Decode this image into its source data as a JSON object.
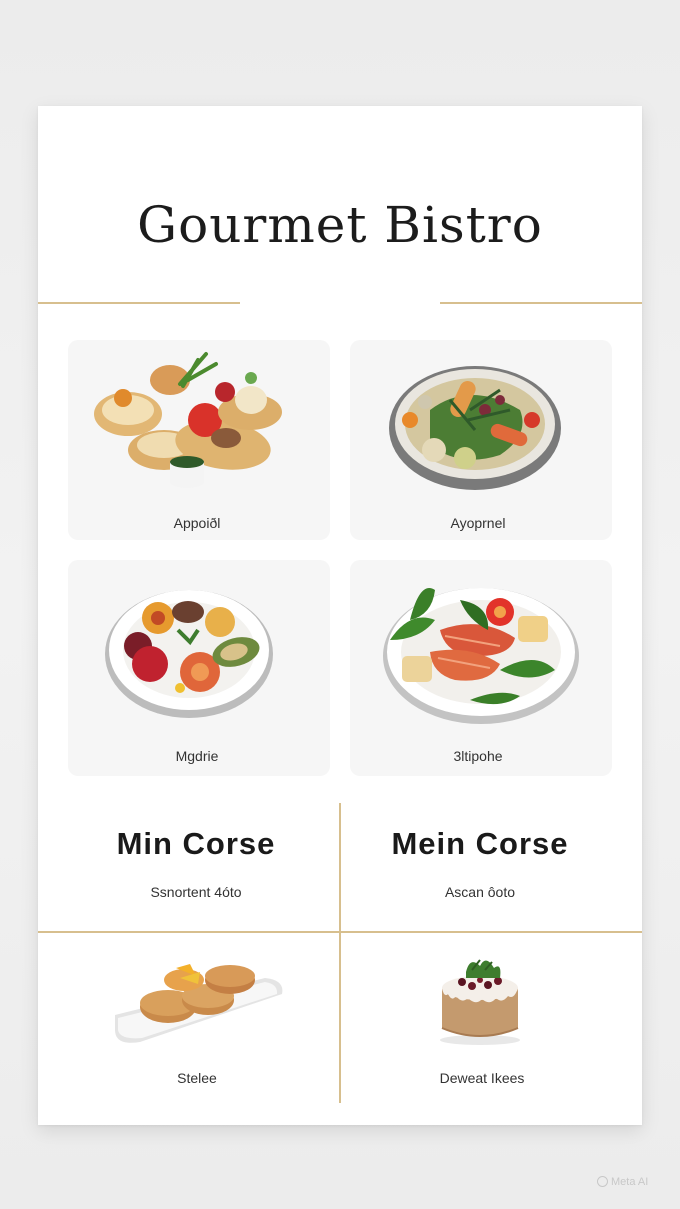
{
  "menu": {
    "title": "Gourmet Bistro",
    "dishes": [
      {
        "label": "Appoiðl"
      },
      {
        "label": "Ayoprnel"
      },
      {
        "label": "Mgdrie"
      },
      {
        "label": "3ltipohe"
      }
    ],
    "courses": [
      {
        "title": "Min Corse",
        "subtitle": "Ssnortent 4óto"
      },
      {
        "title": "Mein Corse",
        "subtitle": "Ascan ôoto"
      }
    ],
    "bottom": [
      {
        "label": "Stelee"
      },
      {
        "label": "Deweat Ikees"
      }
    ]
  },
  "watermark": "Meta AI",
  "colors": {
    "accent_gold": "#d7bf8e",
    "card": "#ffffff"
  }
}
